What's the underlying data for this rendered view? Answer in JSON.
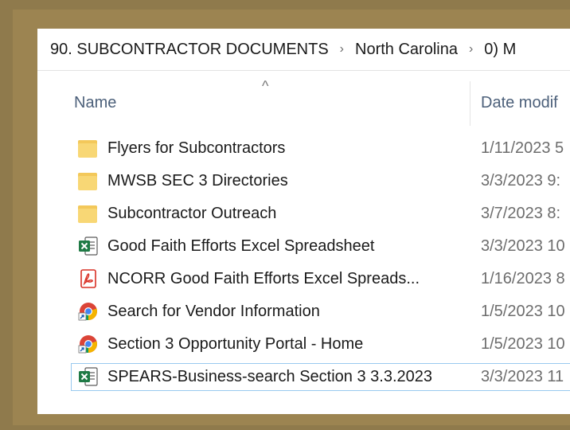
{
  "breadcrumb": {
    "items": [
      "90. SUBCONTRACTOR DOCUMENTS",
      "North Carolina",
      "0) M"
    ],
    "separator": "›"
  },
  "columns": {
    "name": "Name",
    "date": "Date modif",
    "sort_indicator": "^"
  },
  "files": [
    {
      "name": "Flyers for Subcontractors",
      "date": "1/11/2023 5",
      "icon": "folder-icon"
    },
    {
      "name": "MWSB SEC 3 Directories",
      "date": "3/3/2023 9:",
      "icon": "folder-icon"
    },
    {
      "name": "Subcontractor Outreach",
      "date": "3/7/2023 8:",
      "icon": "folder-icon"
    },
    {
      "name": "Good Faith Efforts Excel Spreadsheet",
      "date": "3/3/2023 10",
      "icon": "excel-icon"
    },
    {
      "name": "NCORR Good Faith Efforts Excel Spreads...",
      "date": "1/16/2023 8",
      "icon": "pdf-icon"
    },
    {
      "name": "Search for Vendor Information",
      "date": "1/5/2023 10",
      "icon": "chrome-shortcut-icon"
    },
    {
      "name": "Section 3 Opportunity Portal - Home",
      "date": "1/5/2023 10",
      "icon": "chrome-shortcut-icon"
    },
    {
      "name": "SPEARS-Business-search Section 3 3.3.2023",
      "date": "3/3/2023 11",
      "icon": "excel-icon",
      "selected": true
    }
  ],
  "colors": {
    "frame": "#8f7a4c",
    "folder": "#f8d775",
    "excel": "#1f7a45",
    "pdf": "#d93025",
    "selection_border": "#99c9ef",
    "header_text": "#4c607a"
  }
}
